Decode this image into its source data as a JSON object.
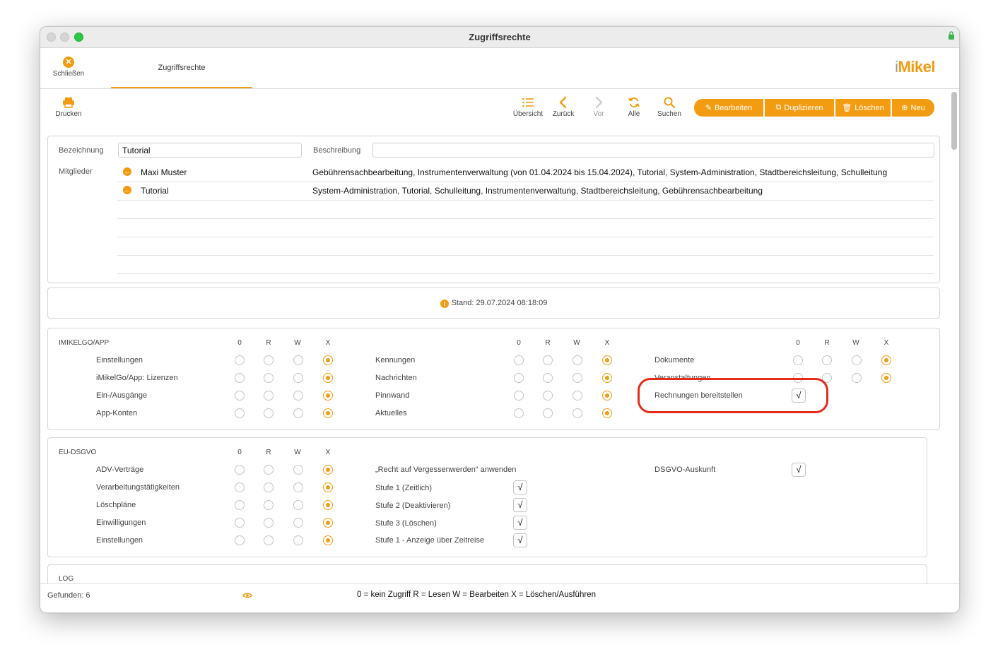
{
  "window": {
    "title": "Zugriffsrechte"
  },
  "topbar": {
    "close_label": "Schließen",
    "tab_label": "Zugriffsrechte",
    "logo_i": "i",
    "logo_rest": "Mikel"
  },
  "toolbar": {
    "print_label": "Drucken",
    "nav": [
      "Übersicht",
      "Zurück",
      "Vor",
      "Alle",
      "Suchen"
    ],
    "actions": [
      "Bearbeiten",
      "Duplizieren",
      "Löschen",
      "Neu"
    ]
  },
  "form": {
    "name_label": "Bezeichnung",
    "name_value": "Tutorial",
    "desc_label": "Beschreibung",
    "desc_value": "",
    "members_label": "Mitglieder",
    "members": [
      {
        "name": "Maxi Muster",
        "desc": "Gebührensachbearbeitung, Instrumentenverwaltung (von 01.04.2024 bis 15.04.2024), Tutorial, System-Administration, Stadtbereichsleitung, Schulleitung"
      },
      {
        "name": "Tutorial",
        "desc": "System-Administration, Tutorial, Schulleitung, Instrumentenverwaltung, Stadtbereichsleitung, Gebührensachbearbeitung"
      }
    ]
  },
  "status": {
    "stand": "Stand: 29.07.2024 08:18:09"
  },
  "columns": [
    "0",
    "R",
    "W",
    "X"
  ],
  "imikelgo": {
    "title": "IMIKELGO/APP",
    "col1": [
      {
        "label": "Einstellungen",
        "value": "X"
      },
      {
        "label": "iMikelGo/App: Lizenzen",
        "value": "X"
      },
      {
        "label": "Ein-/Ausgänge",
        "value": "X"
      },
      {
        "label": "App-Konten",
        "value": "X"
      }
    ],
    "col2": [
      {
        "label": "Kennungen",
        "value": "X"
      },
      {
        "label": "Nachrichten",
        "value": "X"
      },
      {
        "label": "Pinnwand",
        "value": "X"
      },
      {
        "label": "Aktuelles",
        "value": "X"
      }
    ],
    "col3": [
      {
        "label": "Dokumente",
        "value": "X"
      },
      {
        "label": "Veranstaltungen",
        "value": "X"
      }
    ],
    "check_label": "Rechnungen bereitstellen",
    "check_value": "√"
  },
  "dsgvo": {
    "title": "EU-DSGVO",
    "col1": [
      {
        "label": "ADV-Verträge",
        "value": "X"
      },
      {
        "label": "Verarbeitungstätigkeiten",
        "value": "X"
      },
      {
        "label": "Löschpläne",
        "value": "X"
      },
      {
        "label": "Einwilligungen",
        "value": "X"
      },
      {
        "label": "Einstellungen",
        "value": "X"
      }
    ],
    "forget_label": "„Recht auf Vergessenwerden“ anwenden",
    "forget_items": [
      {
        "label": "Stufe 1 (Zeitlich)",
        "value": "√"
      },
      {
        "label": "Stufe 2 (Deaktivieren)",
        "value": "√"
      },
      {
        "label": "Stufe 3 (Löschen)",
        "value": "√"
      },
      {
        "label": "Stufe 1 - Anzeige über Zeitreise",
        "value": "√"
      }
    ],
    "auskunft_label": "DSGVO-Auskunft",
    "auskunft_value": "√"
  },
  "log": {
    "title": "LOG"
  },
  "footer": {
    "found": "Gefunden: 6",
    "legend": "0 = kein Zugriff   R = Lesen   W = Bearbeiten   X = Löschen/Ausführen"
  },
  "colors": {
    "accent": "#f39c12",
    "highlight": "#e52b1a"
  }
}
